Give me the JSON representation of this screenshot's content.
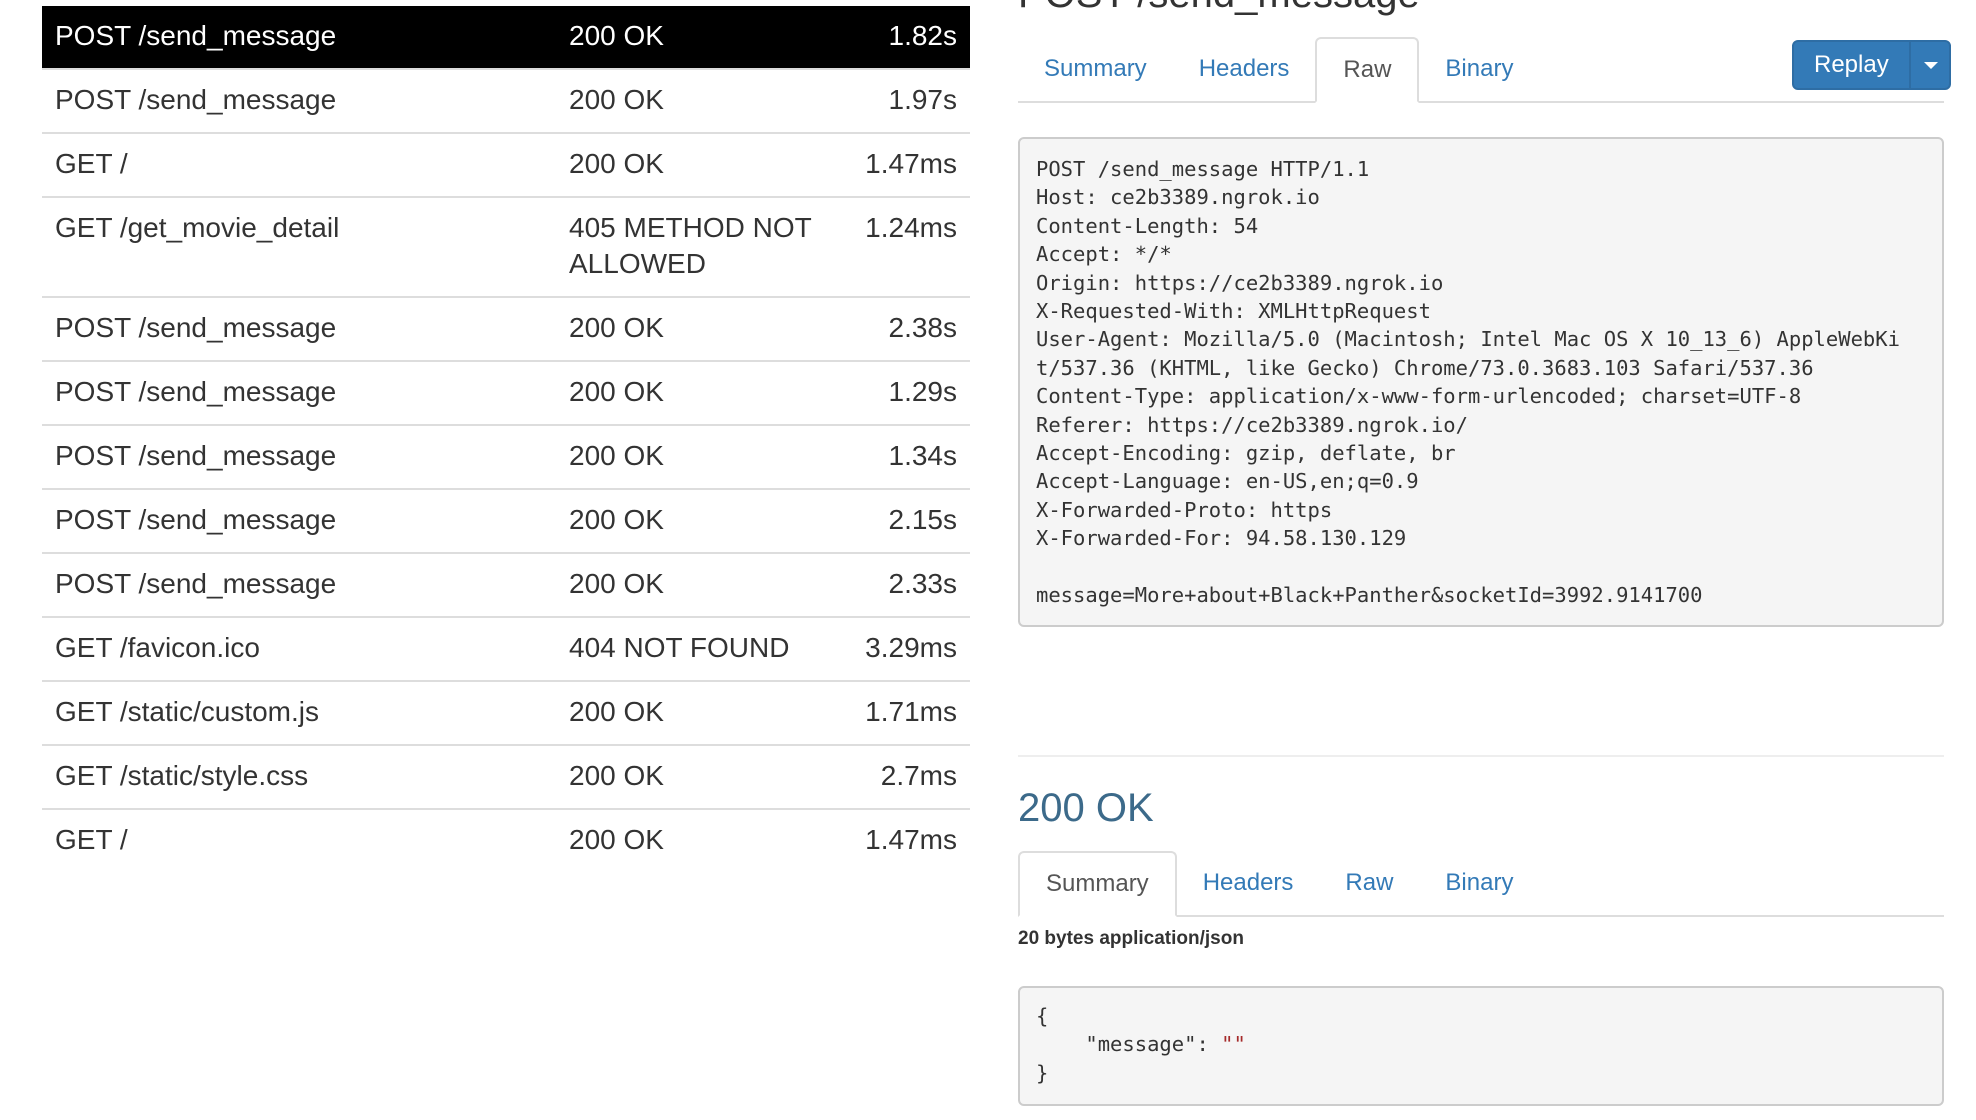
{
  "requests": [
    {
      "path": "POST /send_message",
      "status": "200 OK",
      "time": "1.82s",
      "selected": true
    },
    {
      "path": "POST /send_message",
      "status": "200 OK",
      "time": "1.97s"
    },
    {
      "path": "GET /",
      "status": "200 OK",
      "time": "1.47ms"
    },
    {
      "path": "GET /get_movie_detail",
      "status": "405 METHOD NOT ALLOWED",
      "time": "1.24ms"
    },
    {
      "path": "POST /send_message",
      "status": "200 OK",
      "time": "2.38s"
    },
    {
      "path": "POST /send_message",
      "status": "200 OK",
      "time": "1.29s"
    },
    {
      "path": "POST /send_message",
      "status": "200 OK",
      "time": "1.34s"
    },
    {
      "path": "POST /send_message",
      "status": "200 OK",
      "time": "2.15s"
    },
    {
      "path": "POST /send_message",
      "status": "200 OK",
      "time": "2.33s"
    },
    {
      "path": "GET /favicon.ico",
      "status": "404 NOT FOUND",
      "time": "3.29ms"
    },
    {
      "path": "GET /static/custom.js",
      "status": "200 OK",
      "time": "1.71ms"
    },
    {
      "path": "GET /static/style.css",
      "status": "200 OK",
      "time": "2.7ms"
    },
    {
      "path": "GET /",
      "status": "200 OK",
      "time": "1.47ms"
    }
  ],
  "request_detail": {
    "title": "POST /send_message",
    "tabs": [
      {
        "label": "Summary",
        "active": false
      },
      {
        "label": "Headers",
        "active": false
      },
      {
        "label": "Raw",
        "active": true
      },
      {
        "label": "Binary",
        "active": false
      }
    ],
    "replay_label": "Replay",
    "raw_lines": [
      "POST /send_message HTTP/1.1",
      "Host: ce2b3389.ngrok.io",
      "Content-Length: 54",
      "Accept: */*",
      "Origin: https://ce2b3389.ngrok.io",
      "X-Requested-With: XMLHttpRequest",
      "User-Agent: Mozilla/5.0 (Macintosh; Intel Mac OS X 10_13_6) AppleWebKi",
      "t/537.36 (KHTML, like Gecko) Chrome/73.0.3683.103 Safari/537.36",
      "Content-Type: application/x-www-form-urlencoded; charset=UTF-8",
      "Referer: https://ce2b3389.ngrok.io/",
      "Accept-Encoding: gzip, deflate, br",
      "Accept-Language: en-US,en;q=0.9",
      "X-Forwarded-Proto: https",
      "X-Forwarded-For: 94.58.130.129",
      "",
      "message=More+about+Black+Panther&socketId=3992.9141700"
    ]
  },
  "response_detail": {
    "title": "200 OK",
    "tabs": [
      {
        "label": "Summary",
        "active": true
      },
      {
        "label": "Headers",
        "active": false
      },
      {
        "label": "Raw",
        "active": false
      },
      {
        "label": "Binary",
        "active": false
      }
    ],
    "meta": "20 bytes application/json",
    "json_open": "{",
    "json_key": "    \"message\": ",
    "json_value": "\"\"",
    "json_close": "}"
  }
}
